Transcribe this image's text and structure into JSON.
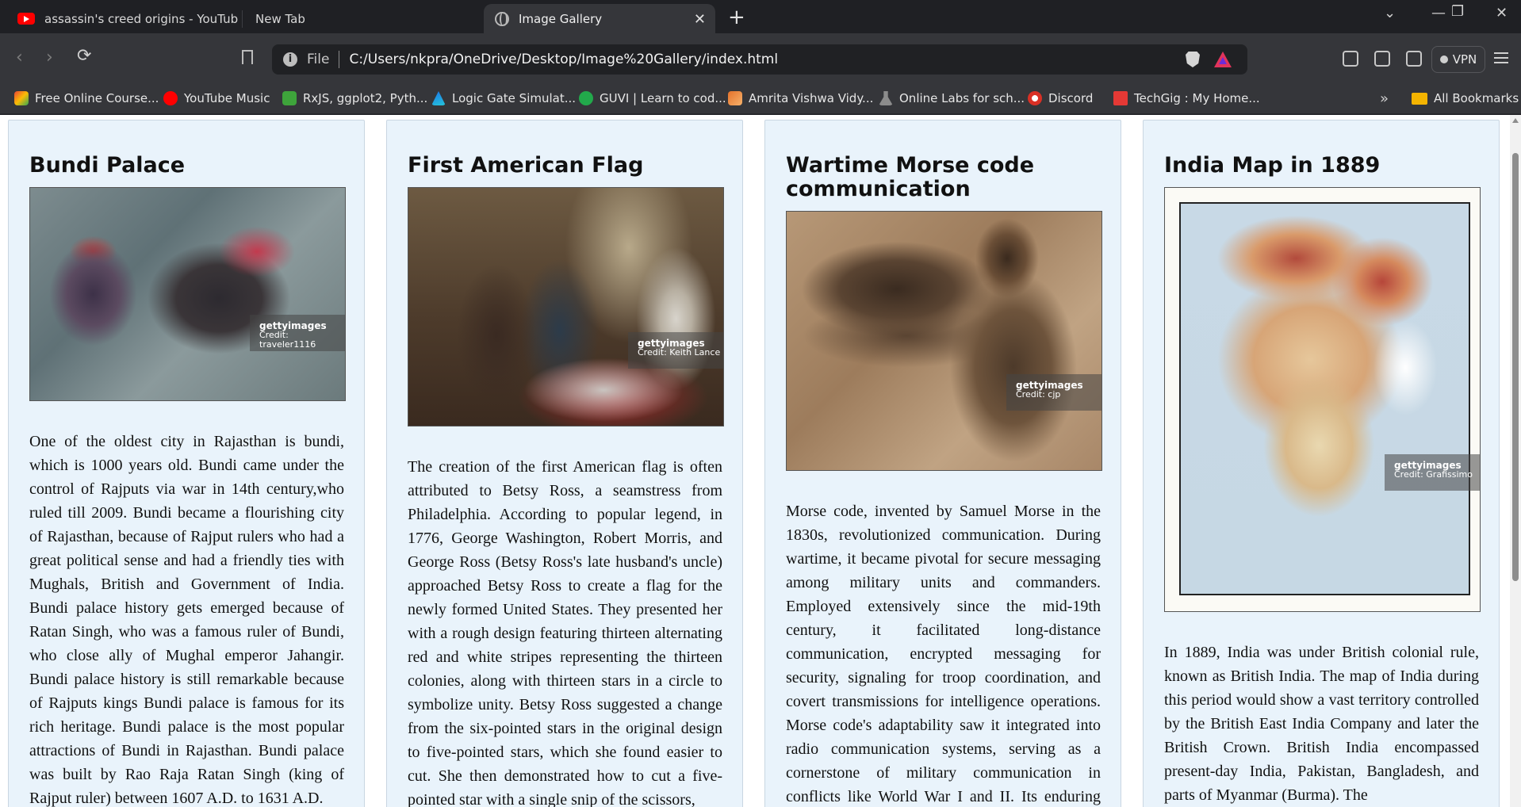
{
  "browser": {
    "tabs": [
      {
        "title": "assassin's creed origins - YouTube"
      },
      {
        "title": "New Tab"
      },
      {
        "title": "Image Gallery"
      }
    ],
    "address": {
      "scheme": "File",
      "url": "C:/Users/nkpra/OneDrive/Desktop/Image%20Gallery/index.html"
    },
    "vpn_label": "VPN",
    "bookmarks": [
      {
        "label": "Free Online Course...",
        "color": "#f4b400"
      },
      {
        "label": "YouTube Music",
        "color": "#ff0000"
      },
      {
        "label": "RxJS, ggplot2, Pyth...",
        "color": "#3ea43b"
      },
      {
        "label": "Logic Gate Simulat...",
        "color": "#1a73e8"
      },
      {
        "label": "GUVI | Learn to cod...",
        "color": "#22a94b"
      },
      {
        "label": "Amrita Vishwa Vidy...",
        "color": "#e5722b"
      },
      {
        "label": "Online Labs for sch...",
        "color": "#8c8c8c"
      },
      {
        "label": "Discord",
        "color": "#d93025"
      },
      {
        "label": "TechGig : My Home...",
        "color": "#e53935"
      }
    ],
    "all_bookmarks": "All Bookmarks"
  },
  "gallery": [
    {
      "title": "Bundi Palace",
      "credit_brand": "gettyimages",
      "credit": "Credit: traveler1116",
      "text": "One of the oldest city in Rajasthan is bundi, which is 1000 years old. Bundi came under the control of Rajputs via war in 14th century,who ruled till 2009. Bundi became a flourishing city of Rajasthan, because of Rajput rulers who had a great political sense and had a friendly ties with Mughals, British and Government of India. Bundi palace history gets emerged because of Ratan Singh, who was a famous ruler of Bundi, who close ally of Mughal emperor Jahangir. Bundi palace history is still remarkable because of Rajputs kings Bundi palace is famous for its rich heritage. Bundi palace is the most popular attractions of Bundi in Rajasthan. Bundi palace was built by Rao Raja Ratan Singh (king of Rajput ruler) between 1607 A.D. to 1631 A.D."
    },
    {
      "title": "First American Flag",
      "credit_brand": "gettyimages",
      "credit": "Credit: Keith Lance",
      "text": "The creation of the first American flag is often attributed to Betsy Ross, a seamstress from Philadelphia. According to popular legend, in 1776, George Washington, Robert Morris, and George Ross (Betsy Ross's late husband's uncle) approached Betsy Ross to create a flag for the newly formed United States. They presented her with a rough design featuring thirteen alternating red and white stripes representing the thirteen colonies, along with thirteen stars in a circle to symbolize unity. Betsy Ross suggested a change from the six-pointed stars in the original design to five-pointed stars, which she found easier to cut. She then demonstrated how to cut a five-pointed star with a single snip of the scissors,"
    },
    {
      "title": "Wartime Morse code communication",
      "credit_brand": "gettyimages",
      "credit": "Credit: cjp",
      "text": "Morse code, invented by Samuel Morse in the 1830s, revolutionized communication. During wartime, it became pivotal for secure messaging among military units and commanders. Employed extensively since the mid-19th century, it facilitated long-distance communication, encrypted messaging for security, signaling for troop coordination, and covert transmissions for intelligence operations. Morse code's adaptability saw it integrated into radio communication systems, serving as a cornerstone of military communication in conflicts like World War I and II. Its enduring legacy underscores its vital role in"
    },
    {
      "title": "India Map in 1889",
      "credit_brand": "gettyimages",
      "credit": "Credit: Grafissimo",
      "text": "In 1889, India was under British colonial rule, known as British India. The map of India during this period would show a vast territory controlled by the British East India Company and later the British Crown. British India encompassed present-day India, Pakistan, Bangladesh, and parts of Myanmar (Burma). The"
    }
  ]
}
